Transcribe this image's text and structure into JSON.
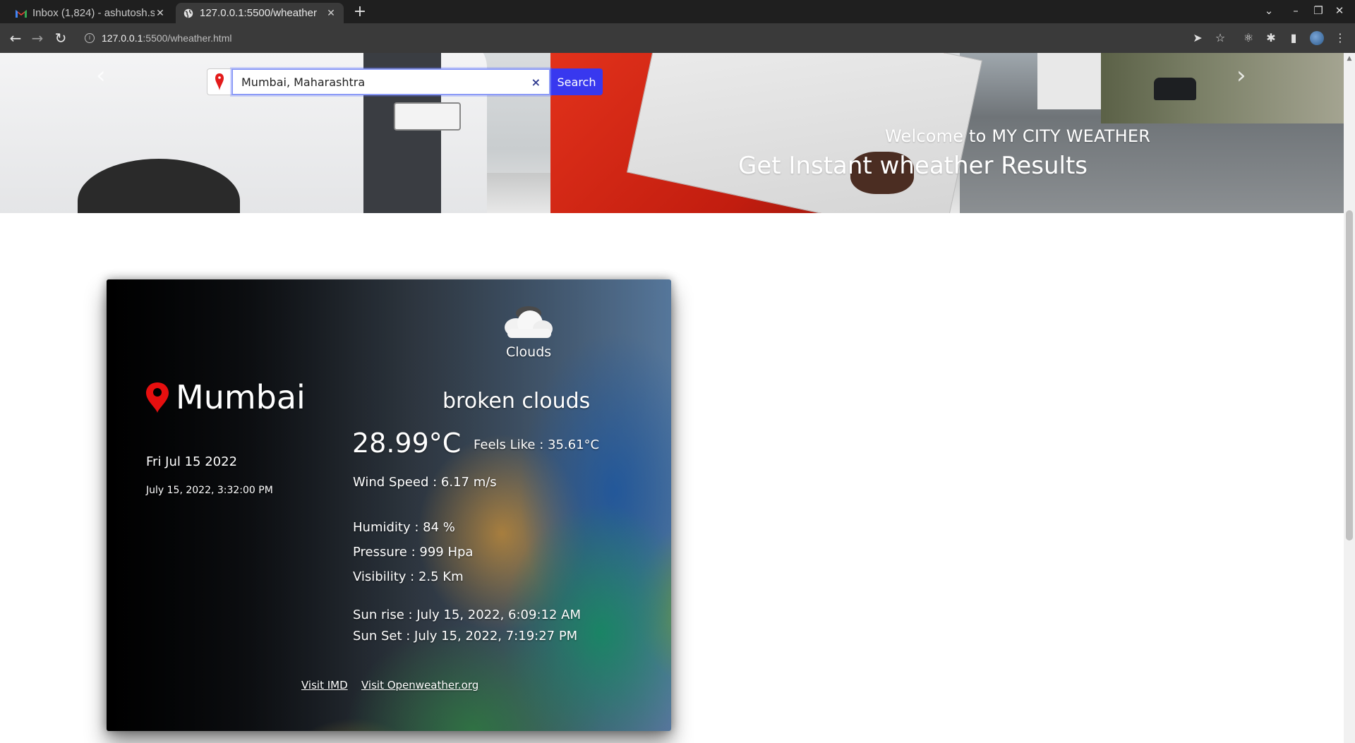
{
  "browser": {
    "tabs": [
      {
        "title": "Inbox (1,824) - ashutosh.s",
        "favicon": "gmail-icon",
        "active": false
      },
      {
        "title": "127.0.0.1:5500/wheather",
        "favicon": "globe-icon",
        "active": true
      }
    ],
    "url_host": "127.0.0.1",
    "url_rest": ":5500/wheather.html"
  },
  "hero": {
    "caption_small": "Welcome to MY CITY WEATHER",
    "caption_large": "Get Instant wheather Results",
    "prev_arrow": "‹",
    "next_arrow": "›"
  },
  "search": {
    "value": "Mumbai, Maharashtra",
    "button_label": "Search",
    "clear_symbol": "×"
  },
  "weather": {
    "city": "Mumbai",
    "date": "Fri Jul 15 2022",
    "datetime": "July 15, 2022, 3:32:00 PM",
    "main": "Clouds",
    "description": "broken clouds",
    "temperature": "28.99°C",
    "feels_like": "Feels Like : 35.61°C",
    "wind": "Wind Speed : 6.17 m/s",
    "humidity": "Humidity : 84 %",
    "pressure": "Pressure : 999 Hpa",
    "visibility": "Visibility : 2.5 Km",
    "sunrise": "Sun rise : July 15, 2022, 6:09:12 AM",
    "sunset": "Sun Set : July 15, 2022, 7:19:27 PM",
    "link_imd": "Visit IMD",
    "link_owm": "Visit Openweather.org"
  },
  "colors": {
    "search_button": "#3838ef",
    "pin_red": "#e31b1b"
  }
}
